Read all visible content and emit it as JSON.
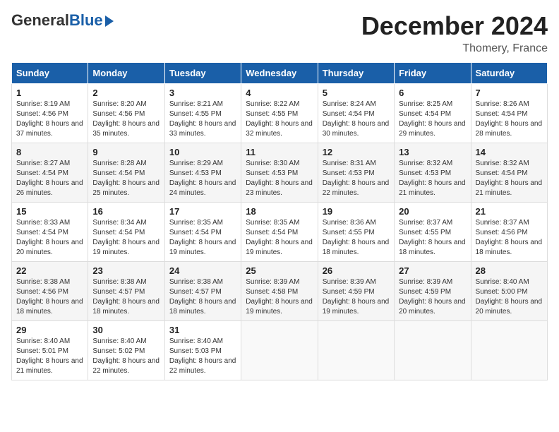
{
  "logo": {
    "general": "General",
    "blue": "Blue"
  },
  "header": {
    "month": "December 2024",
    "location": "Thomery, France"
  },
  "days_of_week": [
    "Sunday",
    "Monday",
    "Tuesday",
    "Wednesday",
    "Thursday",
    "Friday",
    "Saturday"
  ],
  "weeks": [
    [
      {
        "day": "1",
        "sunrise": "8:19 AM",
        "sunset": "4:56 PM",
        "daylight": "8 hours and 37 minutes."
      },
      {
        "day": "2",
        "sunrise": "8:20 AM",
        "sunset": "4:56 PM",
        "daylight": "8 hours and 35 minutes."
      },
      {
        "day": "3",
        "sunrise": "8:21 AM",
        "sunset": "4:55 PM",
        "daylight": "8 hours and 33 minutes."
      },
      {
        "day": "4",
        "sunrise": "8:22 AM",
        "sunset": "4:55 PM",
        "daylight": "8 hours and 32 minutes."
      },
      {
        "day": "5",
        "sunrise": "8:24 AM",
        "sunset": "4:54 PM",
        "daylight": "8 hours and 30 minutes."
      },
      {
        "day": "6",
        "sunrise": "8:25 AM",
        "sunset": "4:54 PM",
        "daylight": "8 hours and 29 minutes."
      },
      {
        "day": "7",
        "sunrise": "8:26 AM",
        "sunset": "4:54 PM",
        "daylight": "8 hours and 28 minutes."
      }
    ],
    [
      {
        "day": "8",
        "sunrise": "8:27 AM",
        "sunset": "4:54 PM",
        "daylight": "8 hours and 26 minutes."
      },
      {
        "day": "9",
        "sunrise": "8:28 AM",
        "sunset": "4:54 PM",
        "daylight": "8 hours and 25 minutes."
      },
      {
        "day": "10",
        "sunrise": "8:29 AM",
        "sunset": "4:53 PM",
        "daylight": "8 hours and 24 minutes."
      },
      {
        "day": "11",
        "sunrise": "8:30 AM",
        "sunset": "4:53 PM",
        "daylight": "8 hours and 23 minutes."
      },
      {
        "day": "12",
        "sunrise": "8:31 AM",
        "sunset": "4:53 PM",
        "daylight": "8 hours and 22 minutes."
      },
      {
        "day": "13",
        "sunrise": "8:32 AM",
        "sunset": "4:53 PM",
        "daylight": "8 hours and 21 minutes."
      },
      {
        "day": "14",
        "sunrise": "8:32 AM",
        "sunset": "4:54 PM",
        "daylight": "8 hours and 21 minutes."
      }
    ],
    [
      {
        "day": "15",
        "sunrise": "8:33 AM",
        "sunset": "4:54 PM",
        "daylight": "8 hours and 20 minutes."
      },
      {
        "day": "16",
        "sunrise": "8:34 AM",
        "sunset": "4:54 PM",
        "daylight": "8 hours and 19 minutes."
      },
      {
        "day": "17",
        "sunrise": "8:35 AM",
        "sunset": "4:54 PM",
        "daylight": "8 hours and 19 minutes."
      },
      {
        "day": "18",
        "sunrise": "8:35 AM",
        "sunset": "4:54 PM",
        "daylight": "8 hours and 19 minutes."
      },
      {
        "day": "19",
        "sunrise": "8:36 AM",
        "sunset": "4:55 PM",
        "daylight": "8 hours and 18 minutes."
      },
      {
        "day": "20",
        "sunrise": "8:37 AM",
        "sunset": "4:55 PM",
        "daylight": "8 hours and 18 minutes."
      },
      {
        "day": "21",
        "sunrise": "8:37 AM",
        "sunset": "4:56 PM",
        "daylight": "8 hours and 18 minutes."
      }
    ],
    [
      {
        "day": "22",
        "sunrise": "8:38 AM",
        "sunset": "4:56 PM",
        "daylight": "8 hours and 18 minutes."
      },
      {
        "day": "23",
        "sunrise": "8:38 AM",
        "sunset": "4:57 PM",
        "daylight": "8 hours and 18 minutes."
      },
      {
        "day": "24",
        "sunrise": "8:38 AM",
        "sunset": "4:57 PM",
        "daylight": "8 hours and 18 minutes."
      },
      {
        "day": "25",
        "sunrise": "8:39 AM",
        "sunset": "4:58 PM",
        "daylight": "8 hours and 19 minutes."
      },
      {
        "day": "26",
        "sunrise": "8:39 AM",
        "sunset": "4:59 PM",
        "daylight": "8 hours and 19 minutes."
      },
      {
        "day": "27",
        "sunrise": "8:39 AM",
        "sunset": "4:59 PM",
        "daylight": "8 hours and 20 minutes."
      },
      {
        "day": "28",
        "sunrise": "8:40 AM",
        "sunset": "5:00 PM",
        "daylight": "8 hours and 20 minutes."
      }
    ],
    [
      {
        "day": "29",
        "sunrise": "8:40 AM",
        "sunset": "5:01 PM",
        "daylight": "8 hours and 21 minutes."
      },
      {
        "day": "30",
        "sunrise": "8:40 AM",
        "sunset": "5:02 PM",
        "daylight": "8 hours and 22 minutes."
      },
      {
        "day": "31",
        "sunrise": "8:40 AM",
        "sunset": "5:03 PM",
        "daylight": "8 hours and 22 minutes."
      },
      null,
      null,
      null,
      null
    ]
  ]
}
